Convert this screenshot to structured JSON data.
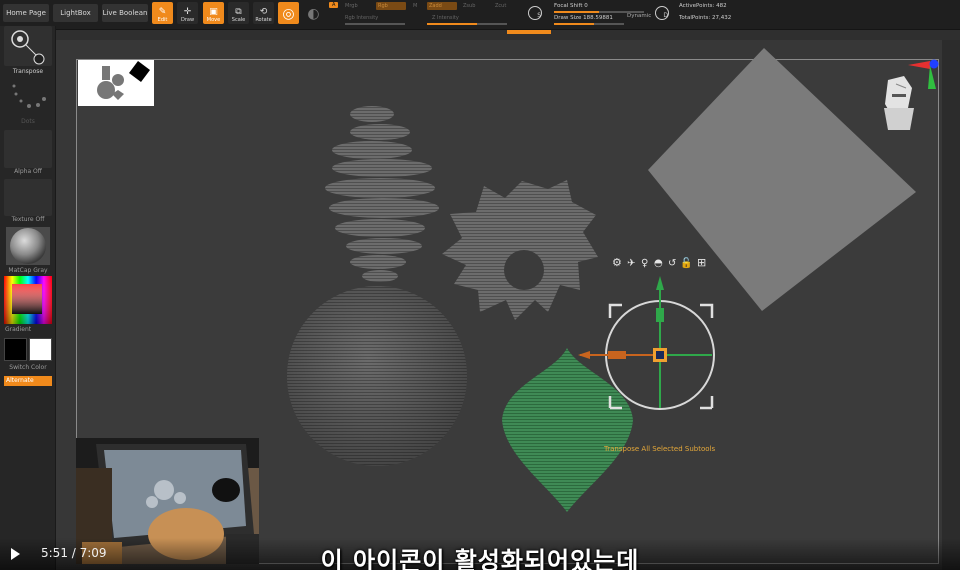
{
  "topbar": {
    "home_page": "Home Page",
    "lightbox": "LightBox",
    "live_boolean": "Live Boolean",
    "tools": [
      {
        "label": "Edit",
        "active": true
      },
      {
        "label": "Draw",
        "active": false
      },
      {
        "label": "Move",
        "active": true
      },
      {
        "label": "Scale",
        "active": false
      },
      {
        "label": "Rotate",
        "active": false
      }
    ],
    "mrgb": "Mrgb",
    "rgb": "Rgb",
    "m": "M",
    "zadd": "Zadd",
    "zsub": "Zsub",
    "zcut": "Zcut",
    "rgb_intensity": "Rgb Intensity",
    "z_intensity": "Z Intensity",
    "focal_shift": "Focal Shift 0",
    "draw_size": "Draw Size 188.59881",
    "dynamic": "Dynamic",
    "active_points": "ActivePoints: 482",
    "total_points": "TotalPoints: 27,432"
  },
  "shelf": {
    "transpose": "Transpose",
    "dots": "Dots",
    "alpha": "Alpha Off",
    "texture": "Texture Off",
    "material": "MatCap Gray",
    "gradient": "Gradient",
    "switch_color": "Switch Color",
    "alternate": "Alternate"
  },
  "viewport": {
    "gizmo_label": "Transpose All Selected Subtools"
  },
  "player": {
    "time": "5:51 / 7:09",
    "subtitle": "이 아이콘이 활성화되어있는데"
  },
  "colors": {
    "accent": "#f08a1c",
    "primary_color": "#000000",
    "secondary_color": "#ffffff"
  }
}
